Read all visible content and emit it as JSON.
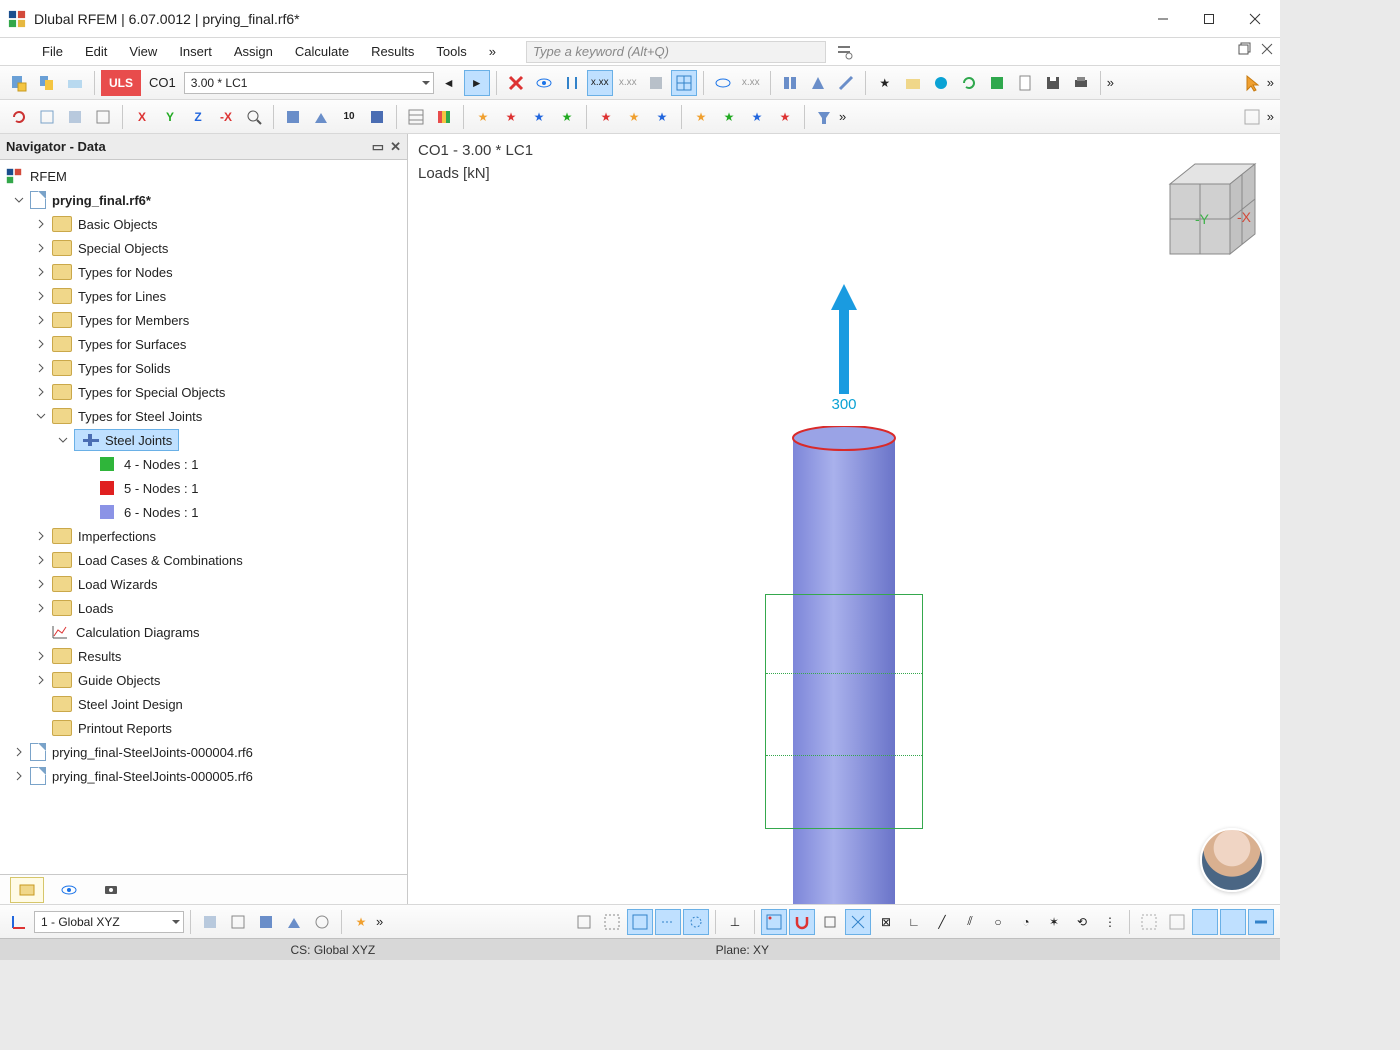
{
  "window": {
    "title": "Dlubal RFEM | 6.07.0012 | prying_final.rf6*"
  },
  "menu": {
    "items": [
      "File",
      "Edit",
      "View",
      "Insert",
      "Assign",
      "Calculate",
      "Results",
      "Tools"
    ],
    "overflow": "»",
    "search_placeholder": "Type a keyword (Alt+Q)"
  },
  "toolbar1": {
    "badge": "ULS",
    "co_label": "CO1",
    "co_desc": "3.00 * LC1"
  },
  "navigator": {
    "title": "Navigator - Data",
    "root": "RFEM",
    "model": "prying_final.rf6*",
    "nodes": [
      "Basic Objects",
      "Special Objects",
      "Types for Nodes",
      "Types for Lines",
      "Types for Members",
      "Types for Surfaces",
      "Types for Solids",
      "Types for Special Objects"
    ],
    "steel_joints_group": "Types for Steel Joints",
    "steel_joints": "Steel Joints",
    "steel_joint_items": [
      {
        "color": "#2fb53a",
        "label": "4 - Nodes : 1"
      },
      {
        "color": "#e02020",
        "label": "5 - Nodes : 1"
      },
      {
        "color": "#8b93e6",
        "label": "6 - Nodes : 1"
      }
    ],
    "nodes2": [
      "Imperfections",
      "Load Cases & Combinations",
      "Load Wizards",
      "Loads"
    ],
    "calc_diag": "Calculation Diagrams",
    "nodes3": [
      "Results",
      "Guide Objects",
      "Steel Joint Design",
      "Printout Reports"
    ],
    "sub_models": [
      "prying_final-SteelJoints-000004.rf6",
      "prying_final-SteelJoints-000005.rf6"
    ]
  },
  "viewport": {
    "label": "CO1 - 3.00 * LC1",
    "sublabel": "Loads [kN]",
    "load_value": "300",
    "navcube": {
      "left": "-Y",
      "right": "-X"
    }
  },
  "bottom": {
    "combo": "1 - Global XYZ"
  },
  "status": {
    "cs": "CS: Global XYZ",
    "plane": "Plane: XY"
  }
}
